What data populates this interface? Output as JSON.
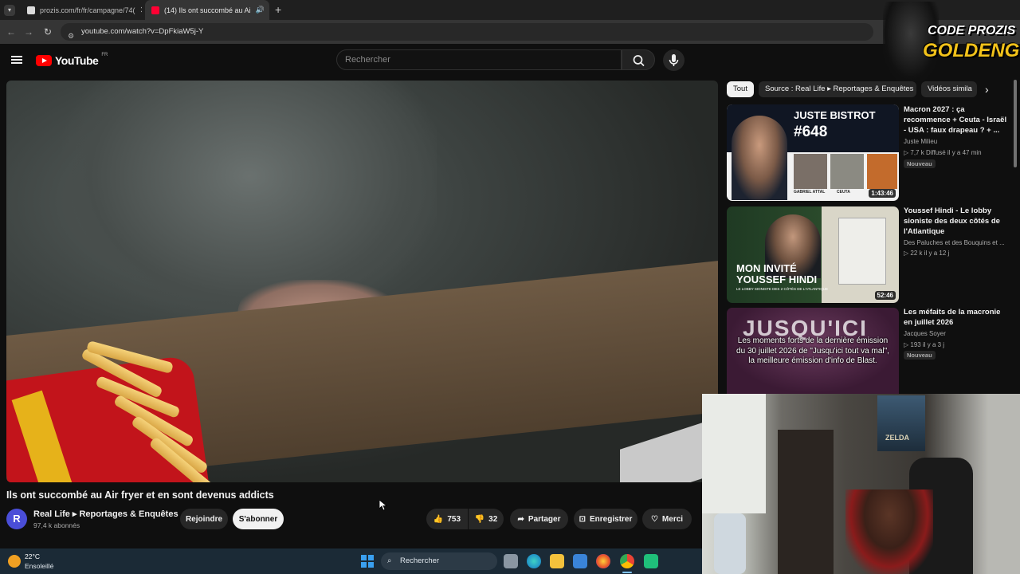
{
  "browser": {
    "tabs": [
      {
        "label": "prozis.com/fr/fr/campagne/74(",
        "close": "✕"
      },
      {
        "label": "(14) Ils ont succombé au Ai",
        "close": "✕"
      }
    ],
    "new_tab": "+",
    "url": "youtube.com/watch?v=DpFkiaW5j-Y"
  },
  "youtube": {
    "logo_text": "YouTube",
    "country": "FR",
    "search_placeholder": "Rechercher"
  },
  "video": {
    "title": "Ils ont succombé au Air fryer et en sont devenus addicts",
    "channel_initial": "R",
    "channel_name": "Real Life ▸ Reportages & Enquêtes",
    "subscribers": "97,4 k abonnés",
    "join_label": "Rejoindre",
    "subscribe_label": "S'abonner",
    "likes": "753",
    "dislikes": "32",
    "share_label": "Partager",
    "save_label": "Enregistrer",
    "thanks_label": "Merci"
  },
  "sidebar": {
    "chips": [
      "Tout",
      "Source : Real Life ▸ Reportages & Enquêtes",
      "Vidéos simila"
    ],
    "items": [
      {
        "title": "Macron 2027 : ça recommence + Ceuta - Israël - USA : faux drapeau ? + ...",
        "channel": "Juste Milieu",
        "meta": "▷ 7,7 k   Diffusé il y a 47 min",
        "badge": "Nouveau",
        "duration": "1:43:46",
        "thumb_heading": "JUSTE BISTROT",
        "thumb_number": "#648",
        "thumb_caption_1": "GABRIEL ATTAL",
        "thumb_caption_2": "CEUTA"
      },
      {
        "title": "Youssef Hindi - Le lobby sioniste des deux côtés de l'Atlantique",
        "channel": "Des Paluches et des Bouquins et ...",
        "meta": "▷ 22 k   il y a 12 j",
        "duration": "52:46",
        "thumb_heading_1": "MON INVITÉ",
        "thumb_heading_2": "YOUSSEF HINDI",
        "thumb_caption": "LE LOBBY SIONISTE DES 2 CÔTÉS DE L'ATLANTIQUE"
      },
      {
        "title": "Les méfaits de la macronie en juillet 2026",
        "channel": "Jacques Soyer",
        "meta": "▷ 193   il y a 3 j",
        "badge": "Nouveau",
        "thumb_heading": "JUSQU'ICI",
        "thumb_text": "Les moments forts de la dernière émission du 30 juillet 2026 de \"Jusqu'ici tout va mal\", la meilleure émission d'info de Blast."
      }
    ]
  },
  "overlay": {
    "logo_line1": "CODE PROZIS",
    "logo_line2": "GOLDENG",
    "poster_text": "ZELDA"
  },
  "taskbar": {
    "temperature": "22°C",
    "weather": "Ensoleillé",
    "search_label": "Rechercher"
  }
}
